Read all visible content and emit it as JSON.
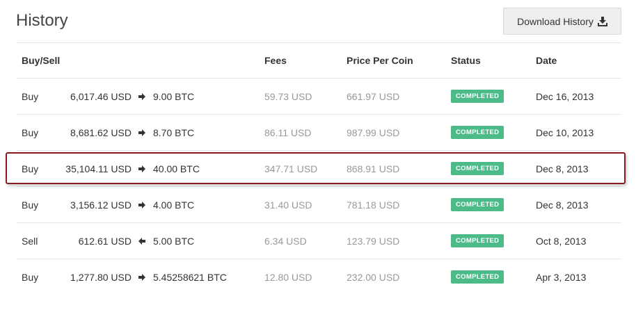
{
  "page": {
    "title": "History"
  },
  "toolbar": {
    "download_label": "Download History",
    "download_icon": "download-tray-icon"
  },
  "table": {
    "headers": {
      "buysell": "Buy/Sell",
      "fees": "Fees",
      "price": "Price Per Coin",
      "status": "Status",
      "date": "Date"
    },
    "rows": [
      {
        "type": "Buy",
        "amount": "6,017.46 USD",
        "arrow": "right",
        "coin": "9.00 BTC",
        "fees": "59.73 USD",
        "price": "661.97 USD",
        "status": "COMPLETED",
        "date": "Dec 16, 2013"
      },
      {
        "type": "Buy",
        "amount": "8,681.62 USD",
        "arrow": "right",
        "coin": "8.70 BTC",
        "fees": "86.11 USD",
        "price": "987.99 USD",
        "status": "COMPLETED",
        "date": "Dec 10, 2013"
      },
      {
        "type": "Buy",
        "amount": "35,104.11 USD",
        "arrow": "right",
        "coin": "40.00 BTC",
        "fees": "347.71 USD",
        "price": "868.91 USD",
        "status": "COMPLETED",
        "date": "Dec 8, 2013"
      },
      {
        "type": "Buy",
        "amount": "3,156.12 USD",
        "arrow": "right",
        "coin": "4.00 BTC",
        "fees": "31.40 USD",
        "price": "781.18 USD",
        "status": "COMPLETED",
        "date": "Dec 8, 2013"
      },
      {
        "type": "Sell",
        "amount": "612.61 USD",
        "arrow": "left",
        "coin": "5.00 BTC",
        "fees": "6.34 USD",
        "price": "123.79 USD",
        "status": "COMPLETED",
        "date": "Oct 8, 2013"
      },
      {
        "type": "Buy",
        "amount": "1,277.80 USD",
        "arrow": "right",
        "coin": "5.45258621 BTC",
        "fees": "12.80 USD",
        "price": "232.00 USD",
        "status": "COMPLETED",
        "date": "Apr 3, 2013"
      }
    ]
  },
  "colors": {
    "status_completed": "#4cbb87",
    "highlight_border": "#8b1a1a",
    "muted_text": "#999999"
  }
}
